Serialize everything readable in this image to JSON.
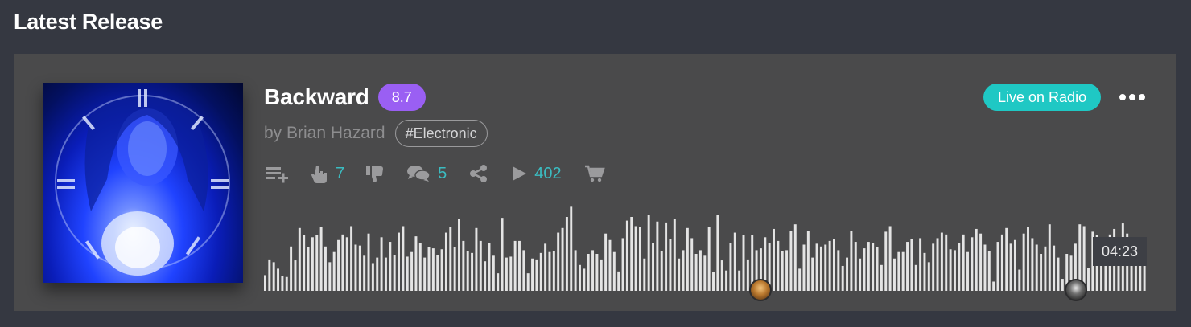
{
  "section": {
    "title": "Latest Release"
  },
  "track": {
    "title": "Backward",
    "rating": "8.7",
    "artist": "by Brian Hazard",
    "genre": "#Electronic",
    "duration": "04:23"
  },
  "actions": {
    "likes": "7",
    "comments": "5",
    "plays": "402"
  },
  "header_actions": {
    "live_label": "Live on Radio"
  },
  "waveform": {
    "played_fraction": 0,
    "bar_heights": [
      0.17,
      0.34,
      0.31,
      0.24,
      0.16,
      0.15,
      0.48,
      0.33,
      0.68,
      0.6,
      0.47,
      0.58,
      0.6,
      0.69,
      0.48,
      0.31,
      0.42,
      0.55,
      0.61,
      0.58,
      0.7,
      0.5,
      0.49,
      0.38,
      0.62,
      0.3,
      0.36,
      0.58,
      0.36,
      0.53,
      0.39,
      0.63,
      0.7,
      0.37,
      0.42,
      0.59,
      0.52,
      0.36,
      0.47,
      0.46,
      0.39,
      0.45,
      0.63,
      0.69,
      0.47,
      0.78,
      0.54,
      0.43,
      0.41,
      0.68,
      0.54,
      0.32,
      0.52,
      0.38,
      0.19,
      0.79,
      0.36,
      0.37,
      0.54,
      0.54,
      0.44,
      0.19,
      0.35,
      0.34,
      0.41,
      0.51,
      0.42,
      0.43,
      0.63,
      0.68,
      0.8,
      0.91,
      0.44,
      0.28,
      0.24,
      0.4,
      0.44,
      0.4,
      0.34,
      0.62,
      0.55,
      0.42,
      0.21,
      0.57,
      0.76,
      0.8,
      0.7,
      0.69,
      0.35,
      0.82,
      0.52,
      0.75,
      0.43,
      0.74,
      0.56,
      0.78,
      0.35,
      0.44,
      0.68,
      0.57,
      0.4,
      0.44,
      0.38,
      0.69,
      0.2,
      0.82,
      0.33,
      0.22,
      0.52,
      0.63,
      0.22,
      0.6,
      0.34,
      0.6,
      0.44,
      0.46,
      0.58,
      0.52,
      0.67,
      0.54,
      0.43,
      0.44,
      0.65,
      0.72,
      0.24,
      0.5,
      0.65,
      0.36,
      0.51,
      0.48,
      0.5,
      0.54,
      0.56,
      0.44,
      0.27,
      0.36,
      0.65,
      0.53,
      0.35,
      0.46,
      0.53,
      0.52,
      0.47,
      0.28,
      0.64,
      0.7,
      0.35,
      0.42,
      0.42,
      0.53,
      0.56,
      0.28,
      0.57,
      0.41,
      0.31,
      0.51,
      0.57,
      0.63,
      0.61,
      0.45,
      0.44,
      0.52,
      0.61,
      0.42,
      0.58,
      0.67,
      0.62,
      0.5,
      0.43,
      0.1,
      0.53,
      0.61,
      0.68,
      0.51,
      0.55,
      0.23,
      0.62,
      0.69,
      0.57,
      0.5,
      0.4,
      0.48,
      0.72,
      0.49,
      0.36,
      0.13,
      0.4,
      0.38,
      0.51,
      0.72,
      0.7,
      0.25,
      0.64,
      0.6,
      0.43,
      0.52,
      0.61,
      0.67,
      0.53,
      0.73,
      0.62,
      0.53,
      0.51,
      0.55,
      0.52
    ]
  },
  "colors": {
    "background": "#353841",
    "card": "#4a4a4b",
    "rating_badge": "#9a5ff3",
    "live_button": "#1fc8c4",
    "count_text": "#3bbcc1",
    "waveform_bar": "#e4e4e4"
  },
  "icons": {
    "add_to_playlist": "playlist-add-icon",
    "like": "hand-pointing-icon",
    "dislike": "thumbs-down-icon",
    "comments": "comments-icon",
    "share": "share-icon",
    "play": "play-icon",
    "buy": "shopping-cart-icon",
    "more": "more-horizontal-icon"
  }
}
